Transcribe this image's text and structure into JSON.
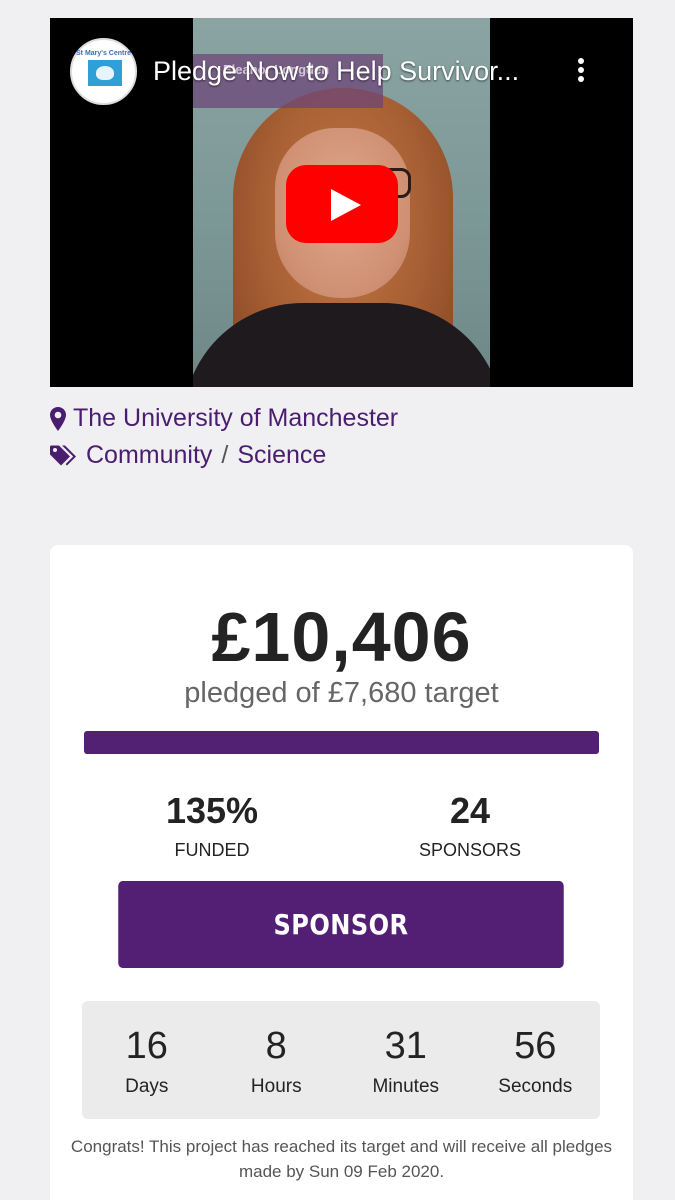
{
  "video": {
    "title": "Pledge Now to Help Survivor...",
    "overlay_name": "Eleanor Longden",
    "logo_text": "St Mary's Centre"
  },
  "location": "The University of Manchester",
  "categories": {
    "first": "Community",
    "separator": "/",
    "second": "Science"
  },
  "funding": {
    "amount": "£10,406",
    "pledged_text": "pledged of £7,680 target",
    "percent_filled": 100,
    "funded_value": "135%",
    "funded_label": "FUNDED",
    "sponsors_value": "24",
    "sponsors_label": "SPONSORS"
  },
  "sponsor_button": "SPONSOR",
  "countdown": [
    {
      "value": "16",
      "label": "Days"
    },
    {
      "value": "8",
      "label": "Hours"
    },
    {
      "value": "31",
      "label": "Minutes"
    },
    {
      "value": "56",
      "label": "Seconds"
    }
  ],
  "congrats": "Congrats! This project has reached its target and will receive all pledges made by Sun 09 Feb 2020.",
  "colors": {
    "brand": "#522173",
    "youtube_red": "#ff0000"
  }
}
